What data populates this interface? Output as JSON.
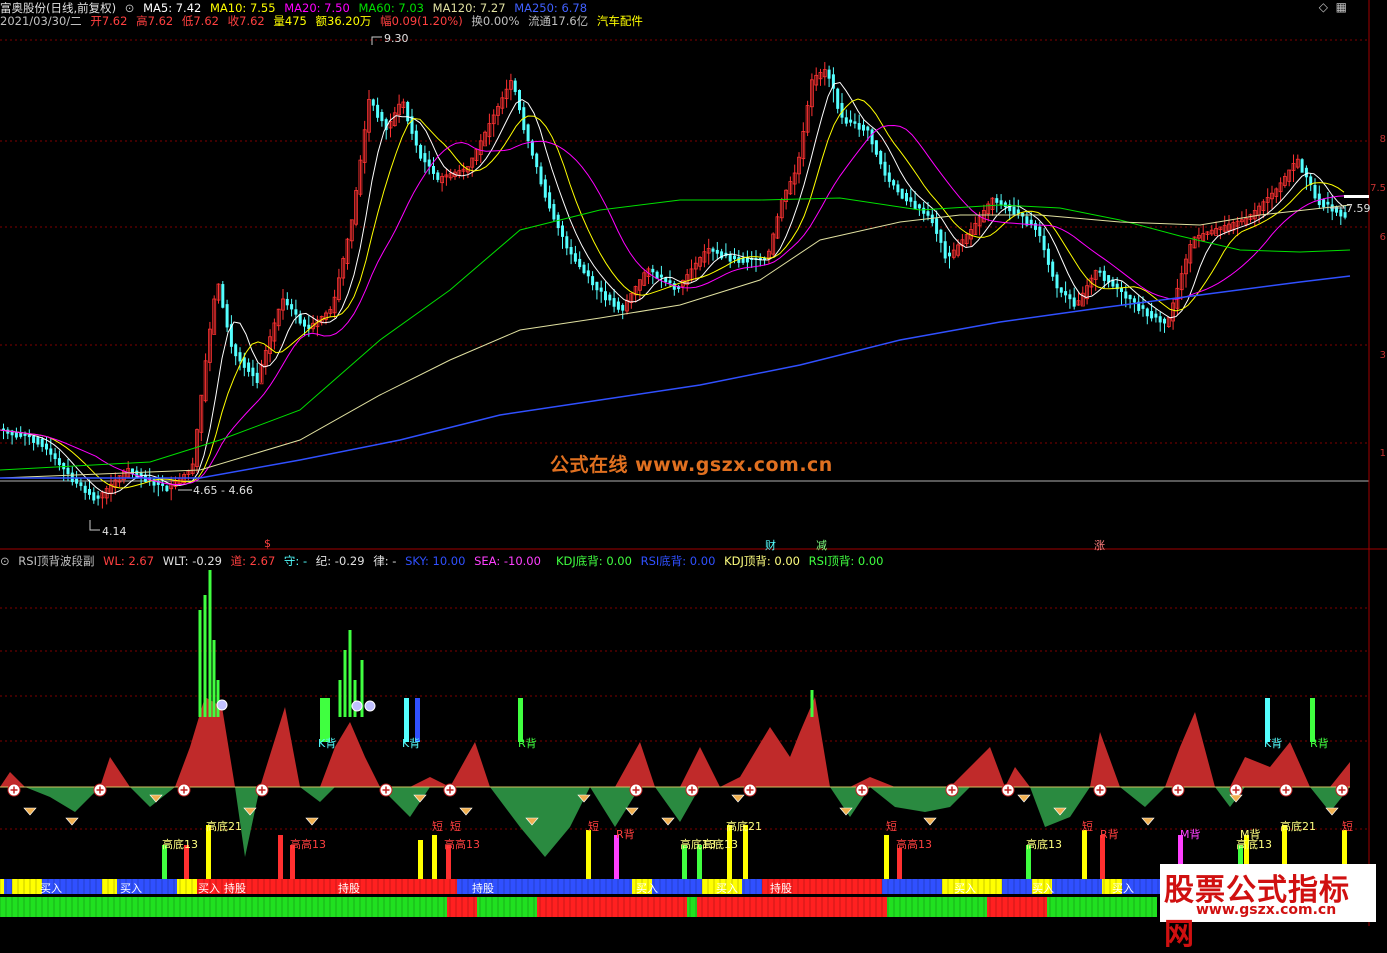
{
  "header": {
    "title": "富奥股份(日线,前复权)",
    "ma5": "MA5: 7.42",
    "ma10": "MA10: 7.55",
    "ma20": "MA20: 7.50",
    "ma60": "MA60: 7.03",
    "ma120": "MA120: 7.27",
    "ma250": "MA250: 6.78"
  },
  "quote": {
    "date": "2021/03/30/二",
    "open": "开7.62",
    "high": "高7.62",
    "low": "低7.62",
    "close": "收7.62",
    "volume": "量475",
    "amount": "额36.20万",
    "change": "幅0.09(1.20%)",
    "turnover": "换0.00%",
    "float": "流通17.6亿",
    "industry": "汽车配件"
  },
  "annotations": {
    "max_price": "9.30",
    "min_price": "4.14",
    "range_label": "4.65 - 4.66",
    "last_price": "7.59"
  },
  "price_axis": [
    "8",
    "7.5",
    "6",
    "3",
    "1"
  ],
  "events": [
    "$",
    "财",
    "减",
    "涨"
  ],
  "indicator": {
    "name": "RSI顶背波段副",
    "wl": "WL: 2.67",
    "wlt": "WLT: -0.29",
    "dao": "道: 2.67",
    "shou": "守: -",
    "ji": "纪: -0.29",
    "lv": "律: -",
    "sky": "SKY: 10.00",
    "sea": "SEA: -10.00",
    "kdj_bottom": "KDJ底背: 0.00",
    "rsi_bottom": "RSI底背: 0.00",
    "kdj_top": "KDJ顶背: 0.00",
    "rsi_top": "RSI顶背: 0.00"
  },
  "signals": {
    "r_back": "R背",
    "k_back": "K背",
    "m_back": "M背",
    "dg21": "高底21",
    "dg13": "高底13",
    "gg13": "高高13",
    "short": "短"
  },
  "bar_labels": [
    "买入",
    "持股"
  ],
  "watermark": "公式在线  www.gszx.com.cn",
  "brand": {
    "name": "股票公式指标网",
    "url": "www.gszx.com.cn"
  },
  "colors": {
    "up": "#ff3232",
    "down": "#54ffff",
    "ma5": "#ffffff",
    "ma10": "#ffff00",
    "ma20": "#ff00ff",
    "ma60": "#00e000",
    "ma120": "#e0e0a0",
    "ma250": "#3050ff"
  }
}
